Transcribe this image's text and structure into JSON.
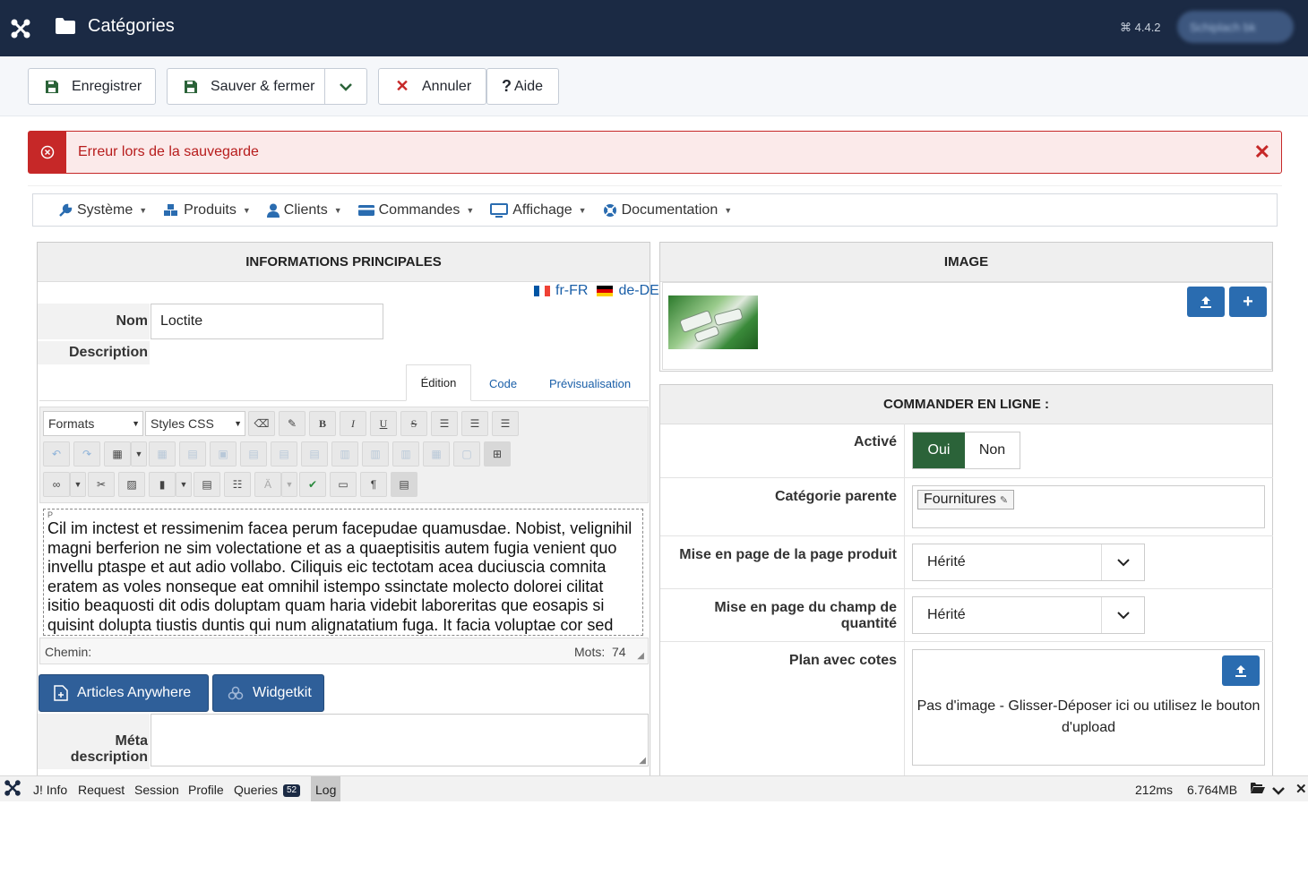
{
  "header": {
    "title": "Catégories",
    "version": "4.4.2",
    "user_label": "Schiplach bk"
  },
  "toolbar": {
    "save": "Enregistrer",
    "save_close": "Sauver & fermer",
    "cancel": "Annuler",
    "help": "Aide"
  },
  "alert": {
    "message": "Erreur lors de la sauvegarde"
  },
  "menu": [
    {
      "label": "Système",
      "icon": "wrench-icon"
    },
    {
      "label": "Produits",
      "icon": "cubes-icon"
    },
    {
      "label": "Clients",
      "icon": "user-icon"
    },
    {
      "label": "Commandes",
      "icon": "credit-card-icon"
    },
    {
      "label": "Affichage",
      "icon": "monitor-icon"
    },
    {
      "label": "Documentation",
      "icon": "lifebuoy-icon"
    }
  ],
  "main_info": {
    "title": "INFORMATIONS PRINCIPALES",
    "languages": [
      "fr-FR",
      "de-DE"
    ],
    "name_label": "Nom",
    "name_value": "Loctite",
    "description_label": "Description",
    "tabs": [
      "Édition",
      "Code",
      "Prévisualisation"
    ],
    "editor": {
      "formats": "Formats",
      "styles": "Styles CSS",
      "p_tag": "P",
      "content": "Cil im inctest et ressimenim facea perum facepudae quamusdae. Nobist, velignihil magni berferion ne sim volectatione et as a quaeptisitis autem fugia venient quo invellu ptaspe et aut adio vollabo. Ciliquis eic tectotam acea duciuscia comnita eratem as voles nonseque eat omnihil istempo ssinctate molecto dolorei cilitat isitio beaquosti dit odis doluptam quam haria videbit laboreritas que eosapis si quisint dolupta tiustis duntis qui num alignatatium fuga. It facia voluptae cor sed quod",
      "path_label": "Chemin:",
      "words_label": "Mots:",
      "words_count": "74"
    },
    "buttons": [
      "Articles Anywhere",
      "Widgetkit"
    ],
    "meta_label": "Méta description"
  },
  "image_panel": {
    "title": "IMAGE"
  },
  "order_panel": {
    "title": "COMMANDER EN LIGNE :",
    "active_label": "Activé",
    "yes": "Oui",
    "no": "Non",
    "parent_label": "Catégorie parente",
    "parent_value": "Fournitures",
    "layout_label": "Mise en page de la page produit",
    "layout_value": "Hérité",
    "qty_label": "Mise en page du champ de quantité",
    "qty_value": "Hérité",
    "plan_label": "Plan avec cotes",
    "plan_text": "Pas d'image - Glisser-Déposer ici ou utilisez le bouton d'upload"
  },
  "debug": {
    "items": [
      "J! Info",
      "Request",
      "Session",
      "Profile",
      "Queries",
      "Log"
    ],
    "queries_count": "52",
    "time": "212ms",
    "memory": "6.764MB"
  },
  "colors": {
    "navy": "#1b2a44",
    "primary": "#2f5f99",
    "danger": "#c62828",
    "success": "#2b6339"
  }
}
